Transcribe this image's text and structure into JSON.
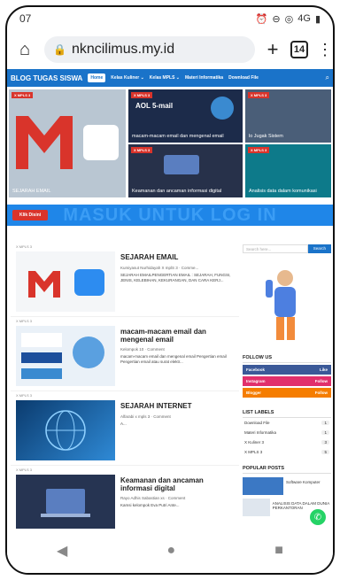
{
  "status": {
    "time": "07",
    "icons": [
      "alarm-icon",
      "minus-circle-icon",
      "hotspot-icon",
      "signal-4g-icon",
      "battery-icon"
    ],
    "signal": "4G"
  },
  "browser": {
    "url": "nkncilimus.my.id",
    "tab_count": "14"
  },
  "site": {
    "brand": "BLOG TUGAS SISWA",
    "nav": [
      "Home",
      "Kelas Kuliner ⌄",
      "Kelas MPLS ⌄",
      "Materi Informatika",
      "Download File"
    ],
    "tiles": [
      {
        "tag": "X MPLS 3",
        "caption": "SEJARAH EMAIL"
      },
      {
        "tag": "X MPLS 3",
        "caption": "macam-macam email dan mengenal email",
        "logo": "AOL 5-mail"
      },
      {
        "tag": "X MPLS 3",
        "caption": "lo Jugak Sistem"
      },
      {
        "tag": "X MPLS 3",
        "caption": "Keamanan dan ancaman informasi digital"
      },
      {
        "tag": "X MPLS 3",
        "caption": "Analisis data dalam komunikasi"
      }
    ],
    "login": {
      "button": "Klik Disini",
      "banner": "MASUK UNTUK LOG IN"
    },
    "posts": [
      {
        "tag": "X MPLS 3",
        "title": "SEJARAH EMAIL",
        "meta": "Kumiyasut Nurhidayah X mplS 3 · Comme...",
        "excerpt": "SEJARAH EMAILPENGERTIAN EMAIL : SEJARAH, FUNGSI, JENIS, KELEBIHAN, KEKURANGAN, DAN CARA KERJ..."
      },
      {
        "tag": "X MPLS 3",
        "title": "macam-macam email dan mengenal email",
        "meta": "Kelompok 10 · Comment",
        "excerpt": "macam-macam email dan mengenal email Pengertian email Pengertian email atau surat elektr..."
      },
      {
        "tag": "X MPLS 3",
        "title": "SEJARAH INTERNET",
        "meta": "Alfarabi x mpls 3 · Comment",
        "excerpt": "A..."
      },
      {
        "tag": "X MPLS 3",
        "title": "Keamanan dan ancaman informasi digital",
        "meta": "Rayo Adhis Sabastian xs · Comment",
        "excerpt": "Kamsi kelompok Eva Putri  Ante..."
      }
    ],
    "sidebar": {
      "search_placeholder": "Search here...",
      "search_button": "Search",
      "follow_title": "FOLLOW US",
      "follow": [
        {
          "name": "Facebook",
          "action": "Like",
          "color": "#3b5998"
        },
        {
          "name": "Instagram",
          "action": "Follow",
          "color": "#e1306c"
        },
        {
          "name": "Blogger",
          "action": "Follow",
          "color": "#f57d00"
        }
      ],
      "labels_title": "LIST LABELS",
      "labels": [
        {
          "name": "Download File",
          "count": "1"
        },
        {
          "name": "Materi Informatika",
          "count": "1"
        },
        {
          "name": "X Kuliner 3",
          "count": "3"
        },
        {
          "name": "X MPLS 3",
          "count": "5"
        }
      ],
      "popular_title": "POPULAR POSTS",
      "popular": [
        {
          "title": "Software Komputer"
        },
        {
          "title": "ANALISIS DATA DALAM DUNIA PERKANTORAN"
        }
      ]
    }
  },
  "colors": {
    "accent": "#1a73c9",
    "red": "#d9342b",
    "banner": "#1f86e8"
  }
}
